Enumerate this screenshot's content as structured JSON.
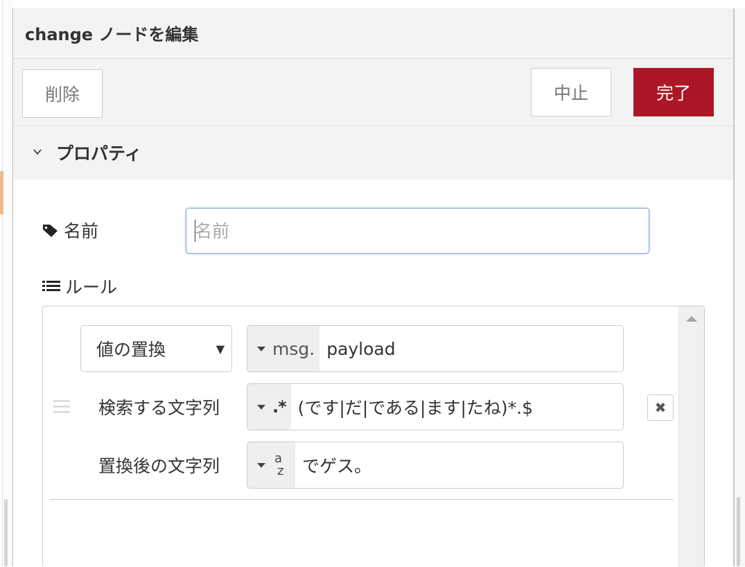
{
  "tray": {
    "title": "change ノードを編集",
    "buttons": {
      "delete": "削除",
      "cancel": "中止",
      "done": "完了"
    }
  },
  "section": {
    "title": "プロパティ"
  },
  "form": {
    "name_label": "名前",
    "name_placeholder": "名前",
    "name_value": "",
    "rules_label": "ルール"
  },
  "rule": {
    "action": "値の置換",
    "target": {
      "type_label": "msg.",
      "value": "payload"
    },
    "search_label": "検索する文字列",
    "search": {
      "type_label": ".*",
      "value": "(です|だ|である|ます|たね)*.$"
    },
    "replace_label": "置換後の文字列",
    "replace": {
      "type_label_a": "a",
      "type_label_z": "z",
      "value": "でゲス。"
    },
    "remove_symbol": "✖"
  },
  "colors": {
    "accent": "#ad1625",
    "focus_border": "#85a7d6",
    "header_bg": "#f3f3f3"
  },
  "icons": {
    "name": "tag-icon",
    "rules": "list-icon",
    "section": "chevron-down-icon"
  }
}
